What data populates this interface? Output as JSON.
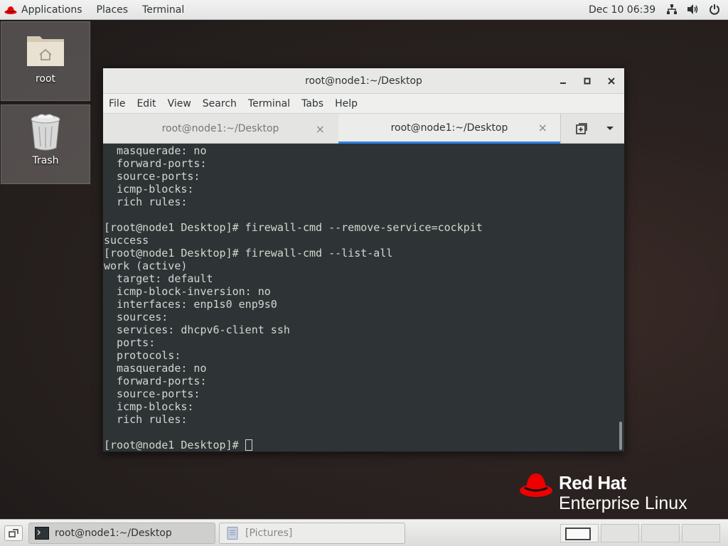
{
  "topbar": {
    "applications": "Applications",
    "places": "Places",
    "terminal": "Terminal",
    "clock": "Dec 10  06:39",
    "tray_icons": [
      "network-icon",
      "volume-icon",
      "power-icon"
    ]
  },
  "desktop": {
    "icons": [
      {
        "label": "root",
        "icon": "home-folder-icon"
      },
      {
        "label": "Trash",
        "icon": "trash-icon"
      }
    ]
  },
  "window": {
    "title": "root@node1:~/Desktop",
    "menu": [
      "File",
      "Edit",
      "View",
      "Search",
      "Terminal",
      "Tabs",
      "Help"
    ],
    "tabs": [
      {
        "label": "root@node1:~/Desktop",
        "active": false
      },
      {
        "label": "root@node1:~/Desktop",
        "active": true
      }
    ]
  },
  "terminal": {
    "lines": [
      "  masquerade: no",
      "  forward-ports: ",
      "  source-ports: ",
      "  icmp-blocks: ",
      "  rich rules: ",
      "",
      "[root@node1 Desktop]# firewall-cmd --remove-service=cockpit",
      "success",
      "[root@node1 Desktop]# firewall-cmd --list-all",
      "work (active)",
      "  target: default",
      "  icmp-block-inversion: no",
      "  interfaces: enp1s0 enp9s0",
      "  sources: ",
      "  services: dhcpv6-client ssh",
      "  ports: ",
      "  protocols: ",
      "  masquerade: no",
      "  forward-ports: ",
      "  source-ports: ",
      "  icmp-blocks: ",
      "  rich rules: ",
      ""
    ],
    "prompt": "[root@node1 Desktop]# "
  },
  "branding": {
    "line1": "Red Hat",
    "line2": "Enterprise Linux",
    "color": "#ee0000"
  },
  "bottombar": {
    "tasks": [
      {
        "label": "root@node1:~/Desktop",
        "icon": "terminal-icon",
        "active": true
      },
      {
        "label": "[Pictures]",
        "icon": "file-manager-icon",
        "active": false
      }
    ],
    "workspaces": 4,
    "active_workspace": 1
  }
}
